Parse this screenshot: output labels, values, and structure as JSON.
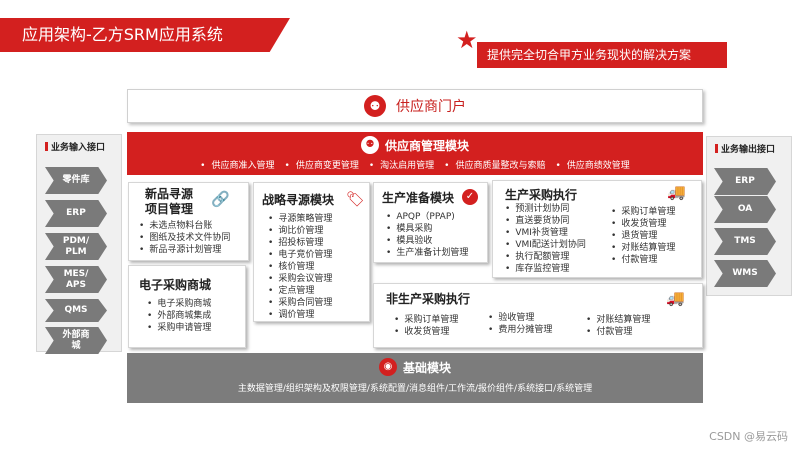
{
  "title": "应用架构-乙方SRM应用系统",
  "slogan": "提供完全切合甲方业务现状的解决方案",
  "portal": {
    "label": "供应商门户",
    "icon": "people-icon"
  },
  "left_panel": {
    "title": "业务输入接口",
    "items": [
      "零件库",
      "ERP",
      "PDM/\nPLM",
      "MES/\nAPS",
      "QMS",
      "外部商\n城"
    ]
  },
  "right_panel": {
    "title": "业务输出接口",
    "items": [
      "ERP",
      "OA",
      "TMS",
      "WMS"
    ]
  },
  "supplier_mgmt": {
    "title": "供应商管理模块",
    "items": [
      "供应商准入管理",
      "供应商变更管理",
      "淘汰启用管理",
      "供应商质量整改与索赔",
      "供应商绩效管理"
    ]
  },
  "new_sourcing": {
    "title_line1": "新品寻源",
    "title_line2": "项目管理",
    "items": [
      "未选点物料台账",
      "图纸及技术文件协同",
      "新品寻源计划管理"
    ]
  },
  "ecommerce": {
    "title": "电子采购商城",
    "items": [
      "电子采购商城",
      "外部商城集成",
      "采购申请管理"
    ]
  },
  "strategic_sourcing": {
    "title": "战略寻源模块",
    "items": [
      "寻源策略管理",
      "询比价管理",
      "招投标管理",
      "电子竞价管理",
      "核价管理",
      "采购会议管理",
      "定点管理",
      "采购合同管理",
      "调价管理"
    ]
  },
  "production_prep": {
    "title": "生产准备模块",
    "items": [
      "APQP（PPAP)",
      "模具采购",
      "模具验收",
      "生产准备计划管理"
    ]
  },
  "production_purchase": {
    "title": "生产采购执行",
    "col1": [
      "预测计划协同",
      "直送要货协同",
      "VMI补货管理",
      "VMI配送计划协同",
      "执行配额管理",
      "库存监控管理"
    ],
    "col2": [
      "采购订单管理",
      "收发货管理",
      "退货管理",
      "对账结算管理",
      "付款管理"
    ]
  },
  "non_production": {
    "title": "非生产采购执行",
    "col1": [
      "采购订单管理",
      "收发货管理"
    ],
    "col2": [
      "验收管理",
      "费用分摊管理"
    ],
    "col3": [
      "对账结算管理",
      "付款管理"
    ]
  },
  "base": {
    "title": "基础模块",
    "desc": "主数据管理/组织架构及权限管理/系统配置/消息组件/工作流/报价组件/系统接口/系统管理"
  },
  "watermark": "CSDN @易云码",
  "colors": {
    "accent": "#d3201f",
    "grey": "#7c7c7c",
    "chevron": "#7a7a7a"
  }
}
